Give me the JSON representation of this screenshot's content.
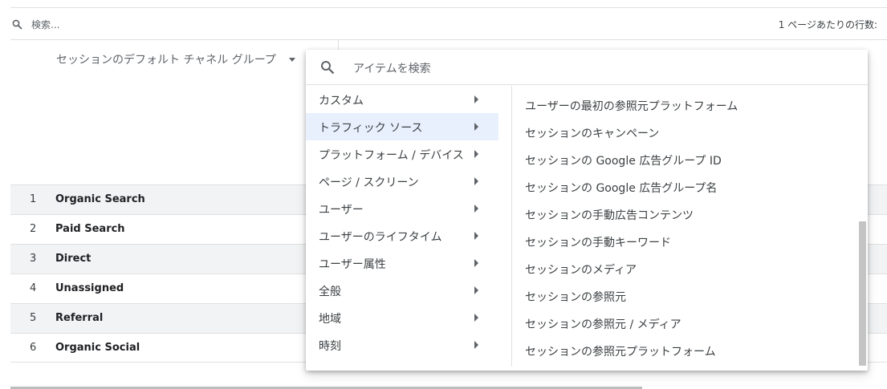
{
  "search": {
    "placeholder": "検索..."
  },
  "rows_per_page": {
    "label": "1 ページあたりの行数:"
  },
  "dimension": {
    "label": "セッションのデフォルト チャネル グループ"
  },
  "table": {
    "rows": [
      {
        "index": "1",
        "name": "Organic Search"
      },
      {
        "index": "2",
        "name": "Paid Search"
      },
      {
        "index": "3",
        "name": "Direct"
      },
      {
        "index": "4",
        "name": "Unassigned"
      },
      {
        "index": "5",
        "name": "Referral"
      },
      {
        "index": "6",
        "name": "Organic Social"
      }
    ]
  },
  "popup": {
    "search_placeholder": "アイテムを検索",
    "categories": [
      {
        "label": "カスタム"
      },
      {
        "label": "トラフィック ソース",
        "active": true
      },
      {
        "label": "プラットフォーム / デバイス"
      },
      {
        "label": "ページ / スクリーン"
      },
      {
        "label": "ユーザー"
      },
      {
        "label": "ユーザーのライフタイム"
      },
      {
        "label": "ユーザー属性"
      },
      {
        "label": "全般"
      },
      {
        "label": "地域"
      },
      {
        "label": "時刻"
      }
    ],
    "subitems": [
      {
        "label": "ユーザーの最初の参照元プラットフォーム"
      },
      {
        "label": "セッションのキャンペーン"
      },
      {
        "label": "セッションの Google 広告グループ ID"
      },
      {
        "label": "セッションの Google 広告グループ名"
      },
      {
        "label": "セッションの手動広告コンテンツ"
      },
      {
        "label": "セッションの手動キーワード"
      },
      {
        "label": "セッションのメディア"
      },
      {
        "label": "セッションの参照元"
      },
      {
        "label": "セッションの参照元 / メディア"
      },
      {
        "label": "セッションの参照元プラットフォーム"
      }
    ]
  },
  "colors": {
    "active_bg": "#e8f0fe",
    "row_stripe": "#f1f3f4",
    "divider": "#e0e0e0"
  },
  "icons": {
    "search": "search-icon",
    "dropdown": "dropdown-arrow-icon",
    "submenu": "chevron-right-icon"
  }
}
